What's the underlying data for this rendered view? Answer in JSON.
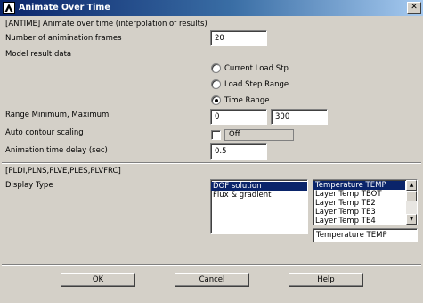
{
  "window": {
    "title": "Animate Over Time"
  },
  "section1": {
    "header": "[ANTIME]  Animate over time (interpolation of results)"
  },
  "frames": {
    "label": "Number of animination frames",
    "value": "20"
  },
  "model_result": {
    "label": "Model result data",
    "options": [
      "Current Load Stp",
      "Load Step Range",
      "Time Range"
    ],
    "selected": "Time Range"
  },
  "range": {
    "label": "Range Minimum, Maximum",
    "min": "0",
    "max": "300"
  },
  "auto_contour": {
    "label": "Auto contour scaling",
    "state": "Off",
    "checked": false
  },
  "delay": {
    "label": "Animation time delay (sec)",
    "value": "0.5"
  },
  "section2": {
    "header": "[PLDI,PLNS,PLVE,PLES,PLVFRC]"
  },
  "display_type": {
    "label": "Display Type",
    "left_items": [
      "DOF solution",
      "Flux & gradient"
    ],
    "left_selected": "DOF solution",
    "right_items": [
      "Temperature TEMP",
      "Layer Temp  TBOT",
      "Layer Temp  TE2",
      "Layer Temp  TE3",
      "Layer Temp  TE4"
    ],
    "right_selected": "Temperature TEMP",
    "right_value": "Temperature TEMP"
  },
  "buttons": {
    "ok": "OK",
    "cancel": "Cancel",
    "help": "Help"
  }
}
